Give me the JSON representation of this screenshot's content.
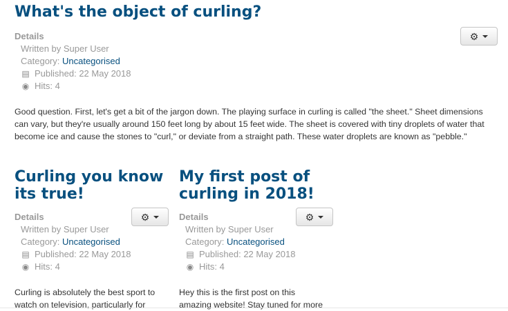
{
  "article_main": {
    "title": "What's the object of curling?",
    "details_label": "Details",
    "author": "Written by Super User",
    "category_prefix": "Category: ",
    "category_link": "Uncategorised",
    "published": "Published: 22 May 2018",
    "hits": "Hits: 4",
    "body": "Good question. First, let's get a bit of the jargon down. The playing surface in curling is called \"the sheet.\" Sheet dimensions can vary, but they're usually around 150 feet long by about 15 feet wide. The sheet is covered with tiny droplets of water that become ice and cause the stones to \"curl,\" or deviate from a straight path. These water droplets are known as \"pebble.\""
  },
  "article_left": {
    "title_line1": "Curling you know",
    "title_line2": "its true!",
    "details_label": "Details",
    "author": "Written by Super User",
    "category_prefix": "Category: ",
    "category_link": "Uncategorised",
    "published": "Published: 22 May 2018",
    "hits": "Hits: 4",
    "body_line1": "Curling is absolutely the best sport to",
    "body_line2": "watch on television, particularly for"
  },
  "article_right": {
    "title_line1": "My first post of",
    "title_line2": "curling in 2018!",
    "details_label": "Details",
    "author": "Written by Super User",
    "category_prefix": "Category: ",
    "category_link": "Uncategorised",
    "published": "Published: 22 May 2018",
    "hits": "Hits: 4",
    "body_line1": "Hey this is the first post on this",
    "body_line2": "amazing website! Stay tuned for more"
  },
  "icons": {
    "gear": "gear-icon",
    "caret": "caret-down-icon",
    "calendar": "calendar-icon",
    "eye": "eye-icon"
  }
}
